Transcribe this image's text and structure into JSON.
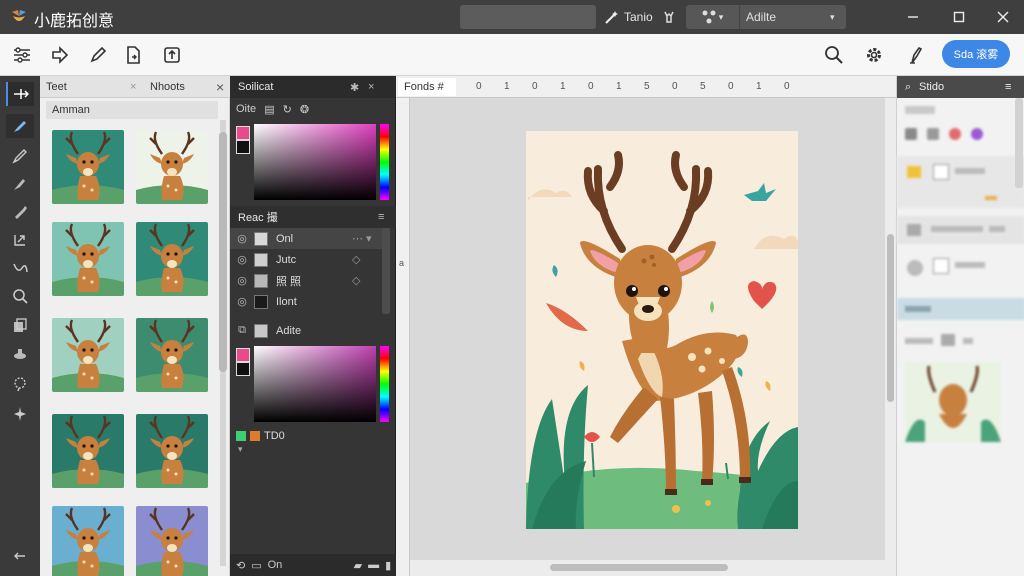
{
  "app": {
    "title": "小鹿拓创意"
  },
  "titlebar": {
    "tool_label": "Tanio",
    "group_label": "Adilte",
    "window_controls": [
      "minimize",
      "maximize",
      "close"
    ]
  },
  "toolbar": {
    "share_label": "Sda 滚雾"
  },
  "assets": {
    "tabs": [
      "Teet",
      "Nhoots"
    ],
    "category": "Amman"
  },
  "color_panel": {
    "title": "Soilicat",
    "sub_label": "Oite",
    "layers_title": "Reac 撮",
    "layers": [
      {
        "name": "Onl",
        "selected": true
      },
      {
        "name": "Jutc",
        "selected": false
      },
      {
        "name": "照 照",
        "selected": false
      },
      {
        "name": "Ilont",
        "selected": false
      },
      {
        "name": "Adite",
        "selected": false
      }
    ],
    "swatch_label": "TD0",
    "footer_label": "On"
  },
  "canvas": {
    "doc_tab": "Fonds #",
    "ruler_labels": [
      "0",
      "1",
      "0",
      "1",
      "0",
      "1",
      "5",
      "0",
      "5",
      "0",
      "1",
      "0"
    ]
  },
  "right_panel": {
    "title": "Stido"
  },
  "colors": {
    "titlebar": "#3f3f3f",
    "accent": "#3d87e6",
    "artboard": "#f8ecdc"
  }
}
